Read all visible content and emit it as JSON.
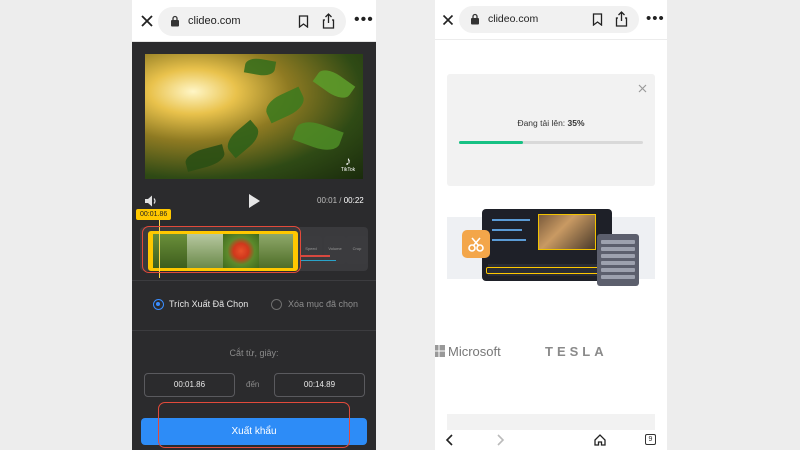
{
  "left_screen": {
    "browser": {
      "url": "clideo.com"
    },
    "player": {
      "current_time": "00:01",
      "separator": "/",
      "total_time": "00:22",
      "watermark": "TikTok"
    },
    "timeline": {
      "playhead_label": "00:01.86",
      "tools": [
        "Speed",
        "Volume",
        "Crop"
      ]
    },
    "options": [
      {
        "label": "Trích Xuất Đã Chọn",
        "selected": true
      },
      {
        "label": "Xóa mục đã chọn",
        "selected": false
      }
    ],
    "trim": {
      "label": "Cắt từ, giây:",
      "start": "00:01.86",
      "to_label": "đến",
      "end": "00:14.89"
    },
    "export_button": "Xuất khẩu"
  },
  "right_screen": {
    "browser": {
      "url": "clideo.com",
      "tab_count": "9"
    },
    "upload": {
      "status_label": "Đang tải lên:",
      "percent_text": "35%",
      "progress": 0.35
    },
    "brands": [
      "Microsoft",
      "TESLA"
    ]
  },
  "colors": {
    "accent_blue": "#2d8cf7",
    "trim_yellow": "#ffc800",
    "highlight_red": "#e24a3b",
    "progress_green": "#17c184"
  },
  "icons": [
    "close-icon",
    "lock-icon",
    "bookmark-icon",
    "share-icon",
    "more-icon",
    "volume-icon",
    "play-icon",
    "scissors-icon",
    "back-icon",
    "forward-icon",
    "home-icon",
    "tabs-icon"
  ]
}
